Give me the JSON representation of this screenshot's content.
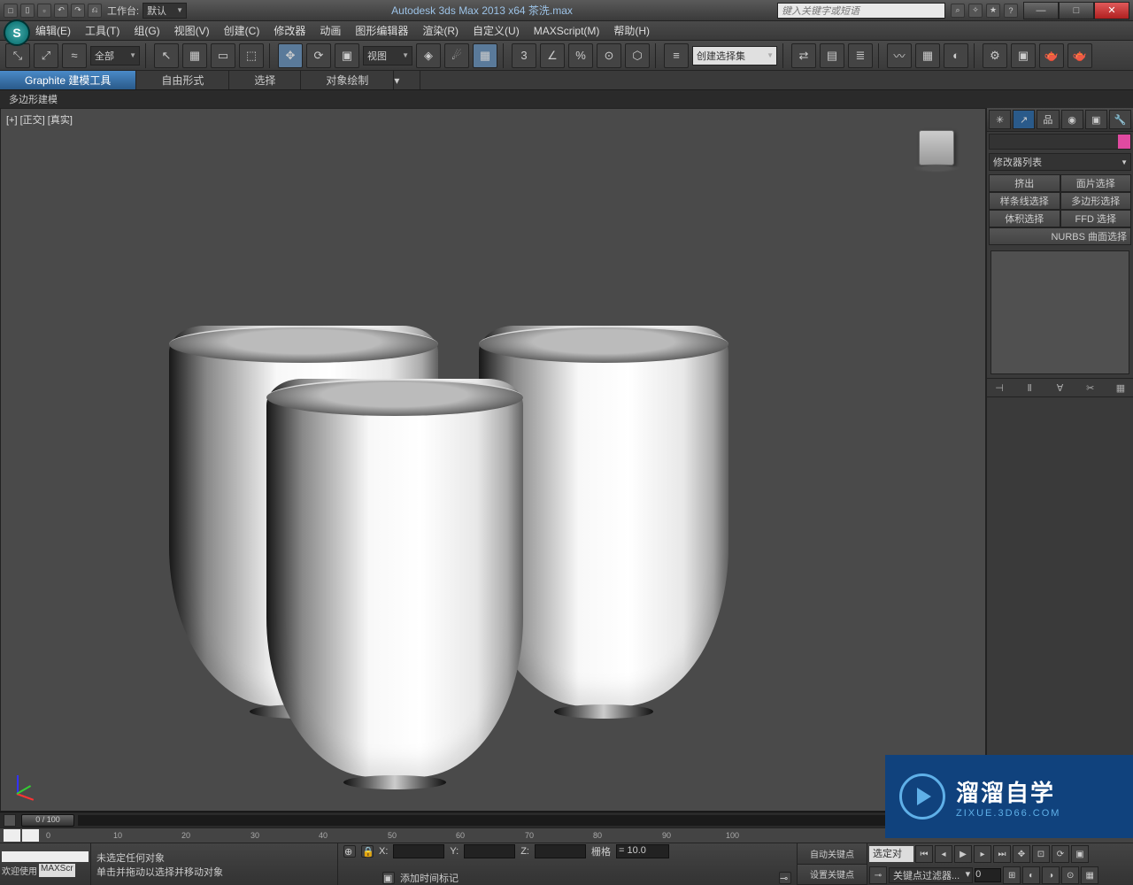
{
  "titlebar": {
    "workspace_label": "工作台:",
    "workspace_value": "默认",
    "app_title": "Autodesk 3ds Max  2013 x64   茶洗.max",
    "search_placeholder": "键入关键字或短语"
  },
  "menu": [
    "编辑(E)",
    "工具(T)",
    "组(G)",
    "视图(V)",
    "创建(C)",
    "修改器",
    "动画",
    "图形编辑器",
    "渲染(R)",
    "自定义(U)",
    "MAXScript(M)",
    "帮助(H)"
  ],
  "toolbar": {
    "filter": "全部",
    "view": "视图",
    "set_combo": "创建选择集"
  },
  "ribbon": {
    "tabs": [
      "Graphite 建模工具",
      "自由形式",
      "选择",
      "对象绘制"
    ],
    "sub": "多边形建模"
  },
  "viewport": {
    "label": "[+] [正交] [真实]"
  },
  "sidepanel": {
    "modlist": "修改器列表",
    "buttons": [
      "挤出",
      "面片选择",
      "样条线选择",
      "多边形选择",
      "体积选择",
      "FFD 选择"
    ],
    "nurbs": "NURBS 曲面选择"
  },
  "timeline": {
    "pos": "0 / 100",
    "ticks": [
      "0",
      "10",
      "20",
      "30",
      "40",
      "50",
      "60",
      "70",
      "80",
      "90",
      "100"
    ]
  },
  "status": {
    "welcome": "欢迎使用",
    "maxscr": "MAXScr",
    "line1": "未选定任何对象",
    "line2": "单击并拖动以选择并移动对象",
    "x": "X:",
    "y": "Y:",
    "z": "Z:",
    "grid_label": "栅格",
    "grid_val": "= 10.0",
    "addtime": "添加时间标记",
    "autokey": "自动关键点",
    "setkey": "设置关键点",
    "selected": "选定对",
    "keyfilter": "关键点过滤器..."
  },
  "watermark": {
    "cn": "溜溜自学",
    "en": "ZIXUE.3D66.COM"
  }
}
